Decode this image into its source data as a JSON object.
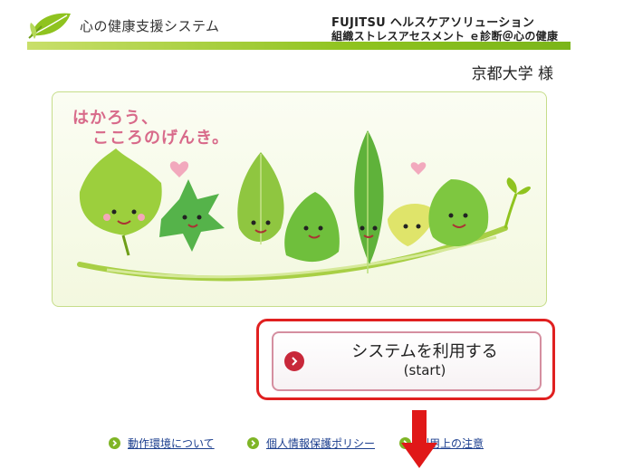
{
  "header": {
    "system_title": "心の健康支援システム",
    "product_line1": "FUJITSU ヘルスケアソリューション",
    "product_line2": "組織ストレスアセスメント ｅ診断＠心の健康"
  },
  "customer": {
    "name": "京都大学 様"
  },
  "banner": {
    "slogan_line1": "はかろう、",
    "slogan_line2": "こころのげんき。"
  },
  "start_button": {
    "label": "システムを利用する",
    "sublabel": "(start)"
  },
  "footer_links": [
    {
      "label": "動作環境について"
    },
    {
      "label": "個人情報保護ポリシー"
    },
    {
      "label": "利用上の注意"
    }
  ],
  "colors": {
    "brand_green": "#8fc31f",
    "slogan_pink": "#d86a8a",
    "highlight_red": "#e02020",
    "link_blue": "#1c3f8f"
  }
}
